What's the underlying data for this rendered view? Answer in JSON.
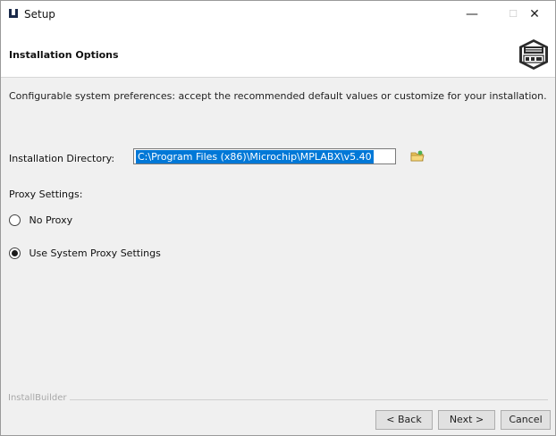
{
  "window": {
    "title": "Setup",
    "minimize_glyph": "—",
    "maximize_glyph": "☐",
    "close_glyph": "✕"
  },
  "header": {
    "heading": "Installation Options",
    "logo_icon": "mplab-xide-logo"
  },
  "main": {
    "description": "Configurable system preferences: accept the recommended default values or customize for your installation.",
    "directory": {
      "label": "Installation Directory:",
      "value": "C:\\Program Files (x86)\\Microchip\\MPLABX\\v5.40",
      "browse_icon": "folder-browse-icon"
    },
    "proxy": {
      "label": "Proxy Settings:",
      "options": [
        {
          "label": "No Proxy",
          "selected": false
        },
        {
          "label": "Use System Proxy Settings",
          "selected": true
        }
      ]
    }
  },
  "footer": {
    "brand": "InstallBuilder",
    "back_label": "< Back",
    "next_label": "Next >",
    "cancel_label": "Cancel"
  }
}
